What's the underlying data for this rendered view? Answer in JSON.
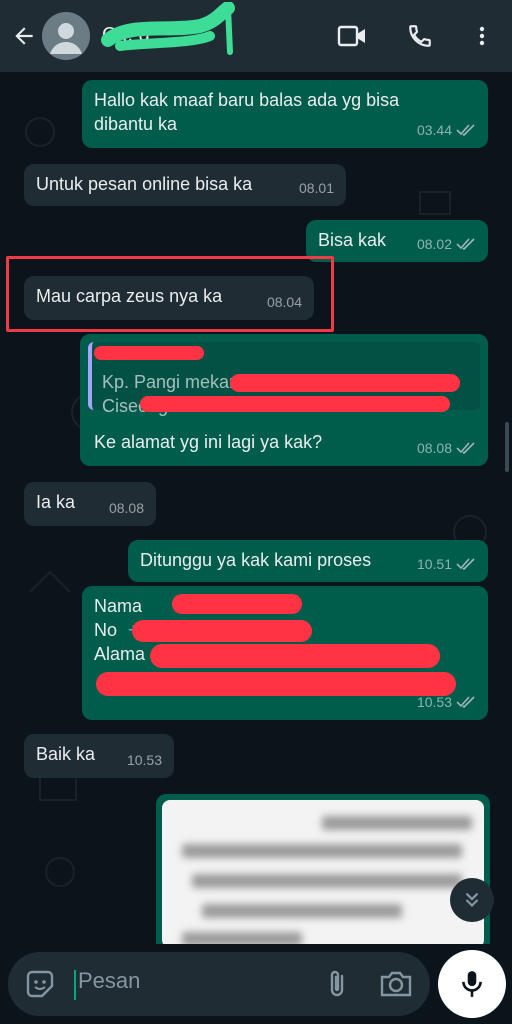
{
  "header": {
    "back_icon": "arrow-left-icon",
    "contact_name": "C... g",
    "video_icon": "video-call-icon",
    "call_icon": "phone-icon",
    "menu_icon": "more-vert-icon"
  },
  "messages": [
    {
      "dir": "out",
      "text_line1": "Hallo kak maaf baru balas ada yg bisa",
      "text_line2": "dibantu ka",
      "time": "03.44"
    },
    {
      "dir": "in",
      "text": "Untuk pesan online bisa ka",
      "time": "08.01"
    },
    {
      "dir": "out",
      "text": "Bisa kak",
      "time": "08.02"
    },
    {
      "dir": "in",
      "text": "Mau carpa zeus nya ka",
      "time": "08.04"
    },
    {
      "dir": "out",
      "quote_line1": "Kp. Pangi mekar ...",
      "quote_line2": "Ciseeng ...",
      "text": "Ke alamat yg ini lagi ya kak?",
      "time": "08.08"
    },
    {
      "dir": "in",
      "text": "Ia ka",
      "time": "08.08"
    },
    {
      "dir": "out",
      "text": "Ditunggu ya kak kami proses",
      "time": "10.51"
    },
    {
      "dir": "out",
      "line1": "Nama",
      "line2": "No",
      "line2_link": "+",
      "line3": "Alama",
      "time": "10.53"
    },
    {
      "dir": "in",
      "text": "Baik ka",
      "time": "10.53"
    }
  ],
  "composer": {
    "placeholder": "Pesan",
    "emoji_icon": "sticker-icon",
    "attach_icon": "paperclip-icon",
    "camera_icon": "camera-icon",
    "mic_icon": "mic-icon"
  },
  "colors": {
    "outgoing_bubble": "#005c4b",
    "incoming_bubble": "#202c33",
    "highlight_box": "#f03a47",
    "redaction": "#ff3344",
    "accent": "#00a884"
  }
}
